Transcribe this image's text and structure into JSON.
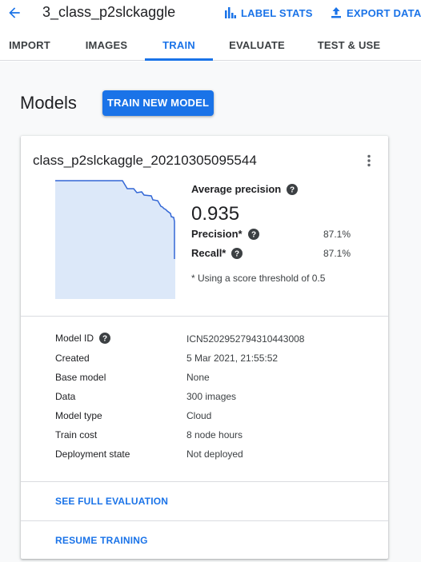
{
  "header": {
    "title": "3_class_p2slckaggle",
    "label_stats": "LABEL STATS",
    "export_data": "EXPORT DATA"
  },
  "tabs": [
    {
      "label": "IMPORT",
      "active": false
    },
    {
      "label": "IMAGES",
      "active": false
    },
    {
      "label": "TRAIN",
      "active": true
    },
    {
      "label": "EVALUATE",
      "active": false
    },
    {
      "label": "TEST & USE",
      "active": false
    }
  ],
  "page": {
    "title": "Models",
    "train_button": "TRAIN NEW MODEL"
  },
  "model": {
    "name": "class_p2slckaggle_20210305095544",
    "avg_precision_label": "Average precision",
    "avg_precision_value": "0.935",
    "precision_label": "Precision*",
    "precision_value": "87.1%",
    "recall_label": "Recall*",
    "recall_value": "87.1%",
    "threshold_note": "* Using a score threshold of 0.5",
    "details": [
      {
        "key": "Model ID",
        "value": "ICN5202952794310443008",
        "help": true
      },
      {
        "key": "Created",
        "value": "5 Mar 2021, 21:55:52",
        "help": false
      },
      {
        "key": "Base model",
        "value": "None",
        "help": false
      },
      {
        "key": "Data",
        "value": "300 images",
        "help": false
      },
      {
        "key": "Model type",
        "value": "Cloud",
        "help": false
      },
      {
        "key": "Train cost",
        "value": "8 node hours",
        "help": false
      },
      {
        "key": "Deployment state",
        "value": "Not deployed",
        "help": false
      }
    ],
    "see_full_evaluation": "SEE FULL EVALUATION",
    "resume_training": "RESUME TRAINING"
  },
  "colors": {
    "accent": "#1a73e8",
    "curve_fill": "#dce8f9",
    "curve_line": "#3367d6"
  },
  "icons": {
    "back": "arrow-back-icon",
    "label_stats": "bar-chart-icon",
    "export": "upload-icon",
    "more": "more-vert-icon",
    "help": "help-circle-icon"
  }
}
